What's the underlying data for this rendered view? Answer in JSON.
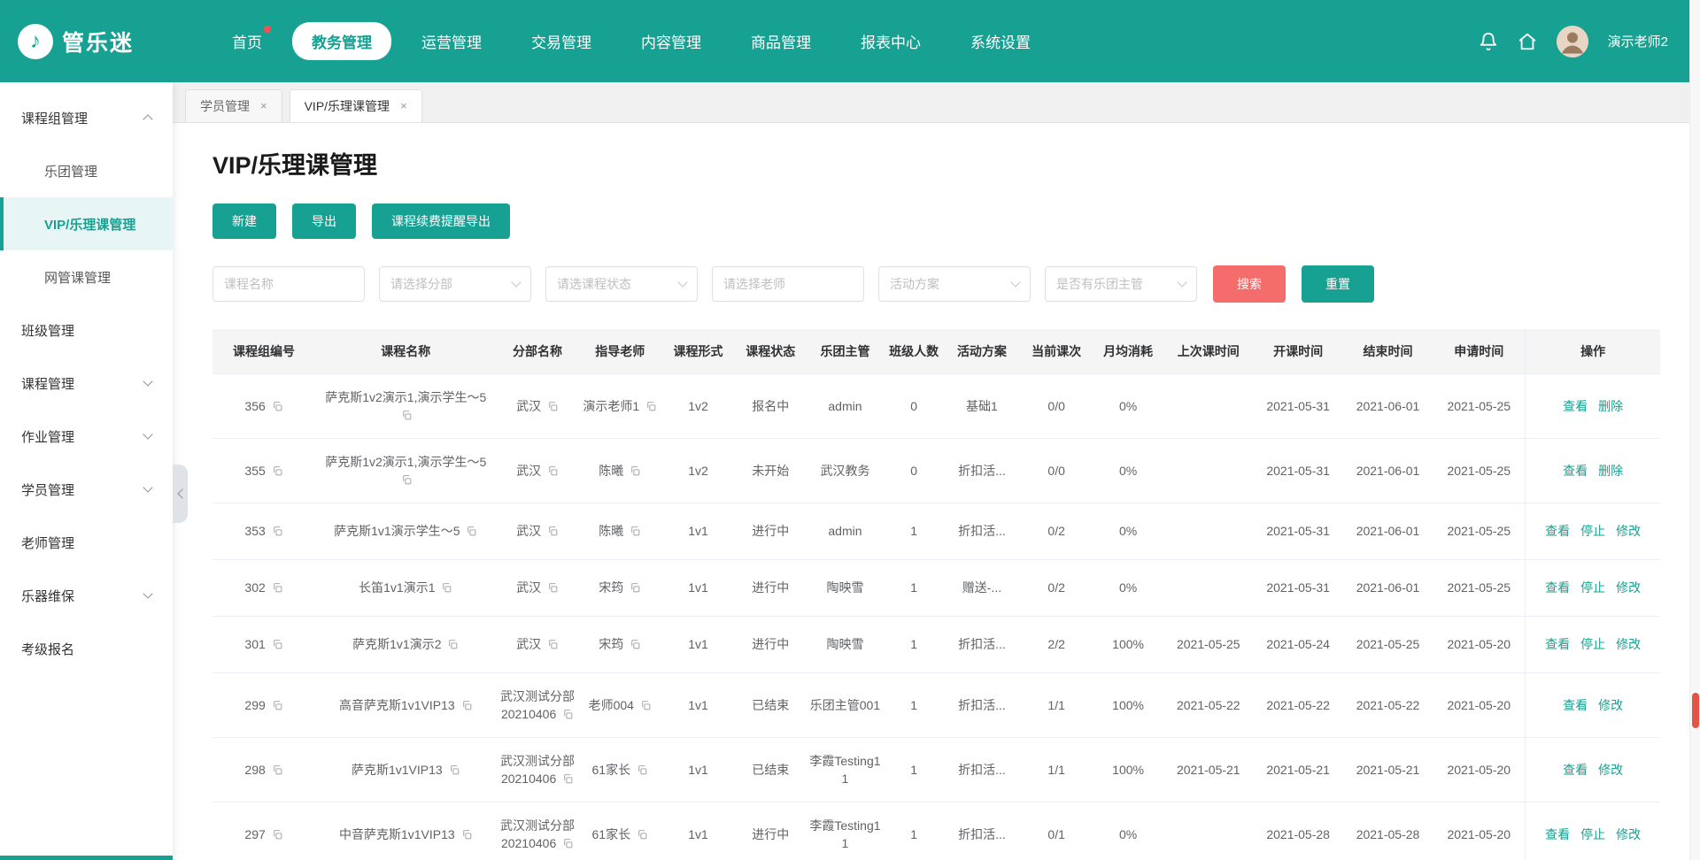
{
  "colors": {
    "accent": "#16a193",
    "danger": "#f56c6c"
  },
  "brand": {
    "name": "管乐迷"
  },
  "topnav": {
    "items": [
      {
        "label": "首页",
        "badge": true
      },
      {
        "label": "教务管理",
        "active": true
      },
      {
        "label": "运营管理"
      },
      {
        "label": "交易管理"
      },
      {
        "label": "内容管理"
      },
      {
        "label": "商品管理"
      },
      {
        "label": "报表中心"
      },
      {
        "label": "系统设置"
      }
    ],
    "user": "演示老师2"
  },
  "sidebar": {
    "items": [
      {
        "label": "课程组管理",
        "chevron": "up",
        "children": [
          {
            "label": "乐团管理"
          },
          {
            "label": "VIP/乐理课管理",
            "active": true
          },
          {
            "label": "网管课管理"
          }
        ]
      },
      {
        "label": "班级管理"
      },
      {
        "label": "课程管理",
        "chevron": "down"
      },
      {
        "label": "作业管理",
        "chevron": "down"
      },
      {
        "label": "学员管理",
        "chevron": "down"
      },
      {
        "label": "老师管理"
      },
      {
        "label": "乐器维保",
        "chevron": "down"
      },
      {
        "label": "考级报名"
      }
    ]
  },
  "tabs": [
    {
      "label": "学员管理",
      "active": false
    },
    {
      "label": "VIP/乐理课管理",
      "active": true
    }
  ],
  "page": {
    "title": "VIP/乐理课管理",
    "actions": [
      "新建",
      "导出",
      "课程续费提醒导出"
    ],
    "filters": [
      {
        "placeholder": "课程名称",
        "type": "input"
      },
      {
        "placeholder": "请选择分部",
        "type": "select"
      },
      {
        "placeholder": "请选课程状态",
        "type": "select"
      },
      {
        "placeholder": "请选择老师",
        "type": "input"
      },
      {
        "placeholder": "活动方案",
        "type": "select"
      },
      {
        "placeholder": "是否有乐团主管",
        "type": "select"
      }
    ],
    "search_label": "搜索",
    "reset_label": "重置"
  },
  "table": {
    "columns": [
      "课程组编号",
      "课程名称",
      "分部名称",
      "指导老师",
      "课程形式",
      "课程状态",
      "乐团主管",
      "班级人数",
      "活动方案",
      "当前课次",
      "月均消耗",
      "上次课时间",
      "开课时间",
      "结束时间",
      "申请时间",
      "操作"
    ],
    "rows": [
      {
        "id": "356",
        "name": "萨克斯1v2演示1,演示学生～5",
        "branch": "武汉",
        "teacher": "演示老师1",
        "form": "1v2",
        "status": "报名中",
        "manager": "admin",
        "size": "0",
        "plan": "基础1",
        "progress": "0/0",
        "consume": "0%",
        "last": "",
        "start": "2021-05-31",
        "end": "2021-06-01",
        "apply": "2021-05-25",
        "ops": [
          "查看",
          "删除"
        ]
      },
      {
        "id": "355",
        "name": "萨克斯1v2演示1,演示学生～5",
        "branch": "武汉",
        "teacher": "陈曦",
        "form": "1v2",
        "status": "未开始",
        "manager": "武汉教务",
        "size": "0",
        "plan": "折扣活...",
        "progress": "0/0",
        "consume": "0%",
        "last": "",
        "start": "2021-05-31",
        "end": "2021-06-01",
        "apply": "2021-05-25",
        "ops": [
          "查看",
          "删除"
        ]
      },
      {
        "id": "353",
        "name": "萨克斯1v1演示学生～5",
        "branch": "武汉",
        "teacher": "陈曦",
        "form": "1v1",
        "status": "进行中",
        "manager": "admin",
        "size": "1",
        "plan": "折扣活...",
        "progress": "0/2",
        "consume": "0%",
        "last": "",
        "start": "2021-05-31",
        "end": "2021-06-01",
        "apply": "2021-05-25",
        "ops": [
          "查看",
          "停止",
          "修改"
        ]
      },
      {
        "id": "302",
        "name": "长笛1v1演示1",
        "branch": "武汉",
        "teacher": "宋筠",
        "form": "1v1",
        "status": "进行中",
        "manager": "陶映雪",
        "size": "1",
        "plan": "赠送-...",
        "progress": "0/2",
        "consume": "0%",
        "last": "",
        "start": "2021-05-31",
        "end": "2021-06-01",
        "apply": "2021-05-25",
        "ops": [
          "查看",
          "停止",
          "修改"
        ]
      },
      {
        "id": "301",
        "name": "萨克斯1v1演示2",
        "branch": "武汉",
        "teacher": "宋筠",
        "form": "1v1",
        "status": "进行中",
        "manager": "陶映雪",
        "size": "1",
        "plan": "折扣活...",
        "progress": "2/2",
        "consume": "100%",
        "last": "2021-05-25",
        "start": "2021-05-24",
        "end": "2021-05-25",
        "apply": "2021-05-20",
        "ops": [
          "查看",
          "停止",
          "修改"
        ]
      },
      {
        "id": "299",
        "name": "高音萨克斯1v1VIP13",
        "branch": "武汉测试分部20210406",
        "teacher": "老师004",
        "form": "1v1",
        "status": "已结束",
        "manager": "乐团主管001",
        "size": "1",
        "plan": "折扣活...",
        "progress": "1/1",
        "consume": "100%",
        "last": "2021-05-22",
        "start": "2021-05-22",
        "end": "2021-05-22",
        "apply": "2021-05-20",
        "ops": [
          "查看",
          "修改"
        ]
      },
      {
        "id": "298",
        "name": "萨克斯1v1VIP13",
        "branch": "武汉测试分部20210406",
        "teacher": "61家长",
        "form": "1v1",
        "status": "已结束",
        "manager": "李霞Testing11",
        "size": "1",
        "plan": "折扣活...",
        "progress": "1/1",
        "consume": "100%",
        "last": "2021-05-21",
        "start": "2021-05-21",
        "end": "2021-05-21",
        "apply": "2021-05-20",
        "ops": [
          "查看",
          "修改"
        ]
      },
      {
        "id": "297",
        "name": "中音萨克斯1v1VIP13",
        "branch": "武汉测试分部20210406",
        "teacher": "61家长",
        "form": "1v1",
        "status": "进行中",
        "manager": "李霞Testing11",
        "size": "1",
        "plan": "折扣活...",
        "progress": "0/1",
        "consume": "0%",
        "last": "",
        "start": "2021-05-28",
        "end": "2021-05-28",
        "apply": "2021-05-20",
        "ops": [
          "查看",
          "停止",
          "修改"
        ]
      }
    ]
  }
}
